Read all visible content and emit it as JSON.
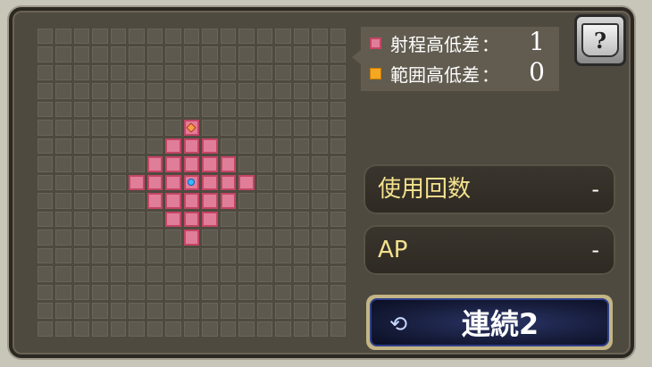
{
  "legend": {
    "shot_label": "射程高低差",
    "shot_value": "1",
    "area_label": "範囲高低差",
    "area_value": "0",
    "colon": "："
  },
  "help": {
    "glyph": "?"
  },
  "stats": {
    "uses_label": "使用回数",
    "uses_value": "-",
    "ap_label": "AP",
    "ap_value": "-"
  },
  "chain": {
    "label": "連続2",
    "icon": "refresh-cycle-icon"
  },
  "grid": {
    "cols": 17,
    "rows": 17,
    "target": [
      5,
      8
    ],
    "center": [
      8,
      8
    ],
    "range": [
      [
        6,
        7
      ],
      [
        6,
        8
      ],
      [
        6,
        9
      ],
      [
        7,
        6
      ],
      [
        7,
        7
      ],
      [
        7,
        8
      ],
      [
        7,
        9
      ],
      [
        7,
        10
      ],
      [
        8,
        5
      ],
      [
        8,
        6
      ],
      [
        8,
        7
      ],
      [
        8,
        9
      ],
      [
        8,
        10
      ],
      [
        8,
        11
      ],
      [
        9,
        6
      ],
      [
        9,
        7
      ],
      [
        9,
        8
      ],
      [
        9,
        9
      ],
      [
        9,
        10
      ],
      [
        10,
        7
      ],
      [
        10,
        8
      ],
      [
        10,
        9
      ],
      [
        11,
        8
      ]
    ]
  },
  "colors": {
    "range_fill": "#e07e99",
    "range_border": "#c44566",
    "area_swatch": "#f5a623",
    "stat_label": "#f3e18e"
  }
}
